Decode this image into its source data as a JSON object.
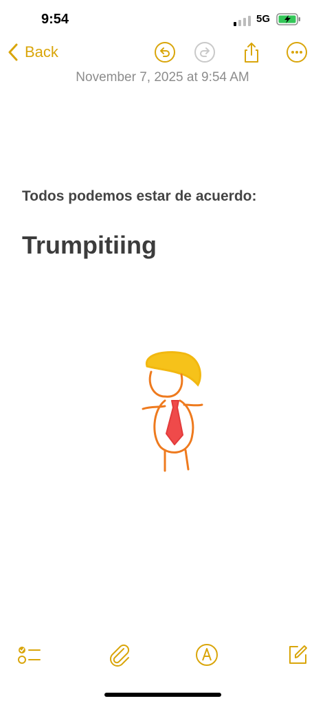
{
  "status_bar": {
    "time": "9:54",
    "network": "5G"
  },
  "nav": {
    "back_label": "Back"
  },
  "note": {
    "date": "November 7, 2025 at 9:54 AM",
    "line1": "Todos podemos estar de acuerdo:",
    "heading": "Trumpitiing"
  },
  "colors": {
    "accent": "#d9a50a",
    "date_gray": "#8c8c8c",
    "text": "#3c3c3c"
  },
  "icons": {
    "nav": [
      "chevron-left-icon",
      "undo-icon",
      "redo-icon",
      "share-icon",
      "more-icon"
    ],
    "toolbar": [
      "checklist-icon",
      "paperclip-icon",
      "markup-pen-icon",
      "compose-icon"
    ]
  }
}
